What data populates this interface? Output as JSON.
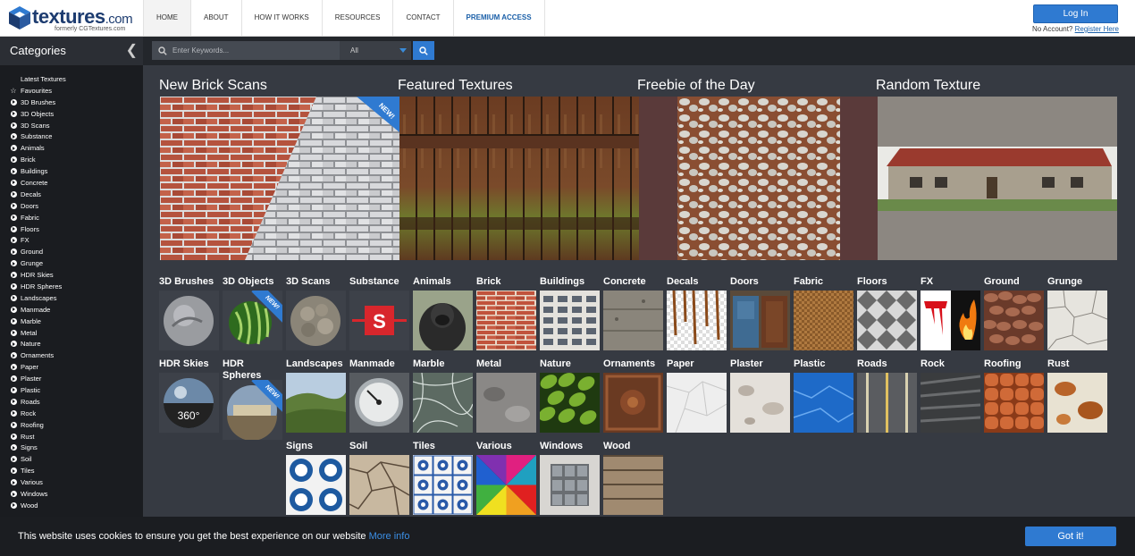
{
  "header": {
    "logo_text": "textures",
    "logo_dotcom": ".com",
    "logo_sub": "formerly CGTextures.com",
    "nav": [
      {
        "label": "HOME",
        "active": true
      },
      {
        "label": "ABOUT"
      },
      {
        "label": "HOW IT WORKS"
      },
      {
        "label": "RESOURCES"
      },
      {
        "label": "CONTACT"
      },
      {
        "label": "PREMIUM ACCESS",
        "premium": true
      }
    ],
    "login_label": "Log In",
    "no_account": "No Account?",
    "register_label": "Register Here"
  },
  "sidebar": {
    "title": "Categories",
    "items": [
      {
        "label": "Latest Textures",
        "icon": "none"
      },
      {
        "label": "Favourites",
        "icon": "star"
      },
      {
        "label": "3D Brushes",
        "icon": "arrow-circle"
      },
      {
        "label": "3D Objects",
        "icon": "arrow-circle"
      },
      {
        "label": "3D Scans",
        "icon": "arrow-circle"
      },
      {
        "label": "Substance",
        "icon": "arrow-circle"
      },
      {
        "label": "Animals",
        "icon": "arrow-circle"
      },
      {
        "label": "Brick",
        "icon": "arrow-circle"
      },
      {
        "label": "Buildings",
        "icon": "arrow-circle"
      },
      {
        "label": "Concrete",
        "icon": "arrow-circle"
      },
      {
        "label": "Decals",
        "icon": "arrow-circle"
      },
      {
        "label": "Doors",
        "icon": "arrow-circle"
      },
      {
        "label": "Fabric",
        "icon": "arrow-circle"
      },
      {
        "label": "Floors",
        "icon": "arrow-circle"
      },
      {
        "label": "FX",
        "icon": "arrow-circle"
      },
      {
        "label": "Ground",
        "icon": "arrow-circle"
      },
      {
        "label": "Grunge",
        "icon": "arrow-circle"
      },
      {
        "label": "HDR Skies",
        "icon": "arrow-circle"
      },
      {
        "label": "HDR Spheres",
        "icon": "arrow-circle"
      },
      {
        "label": "Landscapes",
        "icon": "arrow-circle"
      },
      {
        "label": "Manmade",
        "icon": "arrow-circle"
      },
      {
        "label": "Marble",
        "icon": "arrow-circle"
      },
      {
        "label": "Metal",
        "icon": "arrow-circle"
      },
      {
        "label": "Nature",
        "icon": "arrow-circle"
      },
      {
        "label": "Ornaments",
        "icon": "arrow-circle"
      },
      {
        "label": "Paper",
        "icon": "arrow-circle"
      },
      {
        "label": "Plaster",
        "icon": "arrow-circle"
      },
      {
        "label": "Plastic",
        "icon": "arrow-circle"
      },
      {
        "label": "Roads",
        "icon": "arrow-circle"
      },
      {
        "label": "Rock",
        "icon": "arrow-circle"
      },
      {
        "label": "Roofing",
        "icon": "arrow-circle"
      },
      {
        "label": "Rust",
        "icon": "arrow-circle"
      },
      {
        "label": "Signs",
        "icon": "arrow-circle"
      },
      {
        "label": "Soil",
        "icon": "arrow-circle"
      },
      {
        "label": "Tiles",
        "icon": "arrow-circle"
      },
      {
        "label": "Various",
        "icon": "arrow-circle"
      },
      {
        "label": "Windows",
        "icon": "arrow-circle"
      },
      {
        "label": "Wood",
        "icon": "arrow-circle"
      }
    ]
  },
  "search": {
    "placeholder": "Enter Keywords...",
    "filter_value": "All"
  },
  "featured": [
    {
      "title": "New Brick Scans",
      "badge": "NEW!"
    },
    {
      "title": "Featured Textures"
    },
    {
      "title": "Freebie of the Day"
    },
    {
      "title": "Random Texture"
    }
  ],
  "tiles": [
    {
      "label": "3D Brushes",
      "icon": "3d-brush-sphere"
    },
    {
      "label": "3D Objects",
      "icon": "watermelon",
      "badge": "NEW!"
    },
    {
      "label": "3D Scans",
      "icon": "stone-sphere"
    },
    {
      "label": "Substance",
      "icon": "substance-logo"
    },
    {
      "label": "Animals",
      "icon": "gorilla"
    },
    {
      "label": "Brick",
      "icon": "brick-wall"
    },
    {
      "label": "Buildings",
      "icon": "building-facade"
    },
    {
      "label": "Concrete",
      "icon": "concrete"
    },
    {
      "label": "Decals",
      "icon": "rust-drips"
    },
    {
      "label": "Doors",
      "icon": "doors"
    },
    {
      "label": "Fabric",
      "icon": "woven-fabric"
    },
    {
      "label": "Floors",
      "icon": "floor-tiles"
    },
    {
      "label": "FX",
      "icon": "blood-and-fire"
    },
    {
      "label": "Ground",
      "icon": "gravel"
    },
    {
      "label": "Grunge",
      "icon": "cracked-paint"
    },
    {
      "label": "HDR Skies",
      "icon": "hdr-360",
      "caption": "360°"
    },
    {
      "label": "HDR Spheres",
      "icon": "hdr-sphere",
      "badge": "NEW!"
    },
    {
      "label": "Landscapes",
      "icon": "hills"
    },
    {
      "label": "Manmade",
      "icon": "gauge"
    },
    {
      "label": "Marble",
      "icon": "marble"
    },
    {
      "label": "Metal",
      "icon": "metal"
    },
    {
      "label": "Nature",
      "icon": "leaves"
    },
    {
      "label": "Ornaments",
      "icon": "ornament"
    },
    {
      "label": "Paper",
      "icon": "crumpled-paper"
    },
    {
      "label": "Plaster",
      "icon": "plaster"
    },
    {
      "label": "Plastic",
      "icon": "blue-plastic"
    },
    {
      "label": "Roads",
      "icon": "road"
    },
    {
      "label": "Rock",
      "icon": "rock"
    },
    {
      "label": "Roofing",
      "icon": "roof-tiles"
    },
    {
      "label": "Rust",
      "icon": "rust"
    },
    {
      "label": "Signs",
      "icon": "safety-signs"
    },
    {
      "label": "Soil",
      "icon": "dry-soil"
    },
    {
      "label": "Tiles",
      "icon": "azulejo-tiles"
    },
    {
      "label": "Various",
      "icon": "color-wheel"
    },
    {
      "label": "Windows",
      "icon": "window"
    },
    {
      "label": "Wood",
      "icon": "wood-planks"
    }
  ],
  "cookie": {
    "text": "This website uses cookies to ensure you get the best experience on our website",
    "more": "More info",
    "button": "Got it!"
  },
  "colors": {
    "accent": "#2f7ad1",
    "brand": "#1d3c70"
  }
}
